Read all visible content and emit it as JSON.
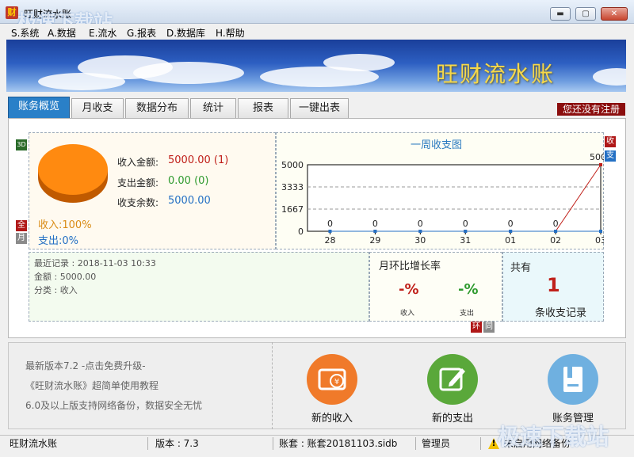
{
  "window": {
    "title": "旺财流水账",
    "app_icon_glyph": "财",
    "minimize_glyph": "▬",
    "maximize_glyph": "▢",
    "close_glyph": "✕"
  },
  "menu": [
    {
      "label": "S.系统"
    },
    {
      "label": "A.数据"
    },
    {
      "label": "E.流水"
    },
    {
      "label": "G.报表"
    },
    {
      "label": "D.数据库"
    },
    {
      "label": "H.帮助"
    }
  ],
  "banner": {
    "title": "旺财流水账"
  },
  "tabs": [
    {
      "label": "账务概览",
      "active": true
    },
    {
      "label": "月收支"
    },
    {
      "label": "数据分布"
    },
    {
      "label": "统计"
    },
    {
      "label": "报表"
    },
    {
      "label": "一键出表"
    }
  ],
  "register_badge": "您还没有注册",
  "side_tags": {
    "threed": "3D",
    "all": "全",
    "month": "月",
    "income": "收",
    "expense": "支",
    "huan": "环",
    "tong": "同"
  },
  "summary": {
    "income_label": "收入金额:",
    "income_value": "5000.00 (1)",
    "expense_label": "支出金额:",
    "expense_value": "0.00 (0)",
    "balance_label": "收支余数:",
    "balance_value": "5000.00",
    "income_pct": "收入:100%",
    "expense_pct": "支出:0%"
  },
  "chart_data": {
    "type": "line",
    "title": "一周收支图",
    "categories": [
      "28",
      "29",
      "30",
      "31",
      "01",
      "02",
      "03"
    ],
    "series": [
      {
        "name": "收",
        "color": "#c0201a",
        "values": [
          0,
          0,
          0,
          0,
          0,
          0,
          5000
        ]
      },
      {
        "name": "支",
        "color": "#2470c4",
        "values": [
          0,
          0,
          0,
          0,
          0,
          0,
          0
        ]
      }
    ],
    "yticks": [
      0,
      1667,
      3333,
      5000
    ],
    "ylim": [
      0,
      5000
    ],
    "grid": true
  },
  "recent": {
    "last_record": "最近记录 : 2018-11-03 10:33",
    "amount": "金额 : 5000.00",
    "category": "分类 : 收入"
  },
  "growth": {
    "title": "月环比增长率",
    "income_pct": "-%",
    "income_label": "收入",
    "expense_pct": "-%",
    "expense_label": "支出"
  },
  "count": {
    "label": "共有",
    "value": "1",
    "desc": "条收支记录"
  },
  "news": [
    "最新版本7.2 -点击免费升级-",
    "《旺财流水账》超简单使用教程",
    "6.0及以上版支持网络备份，数据安全无忧"
  ],
  "actions": [
    {
      "label": "新的收入",
      "color": "#f07a2a",
      "icon": "income-icon"
    },
    {
      "label": "新的支出",
      "color": "#5aa83a",
      "icon": "edit-icon"
    },
    {
      "label": "账务管理",
      "color": "#6fb0e0",
      "icon": "book-icon"
    }
  ],
  "status": {
    "app": "旺财流水账",
    "version": "版本 : 7.3",
    "book": "账套 : 账套20181103.sidb",
    "user": "管理员",
    "backup": "未启用网络备份",
    "warning_glyph": "!"
  },
  "watermark": {
    "text": "极速下载站"
  }
}
